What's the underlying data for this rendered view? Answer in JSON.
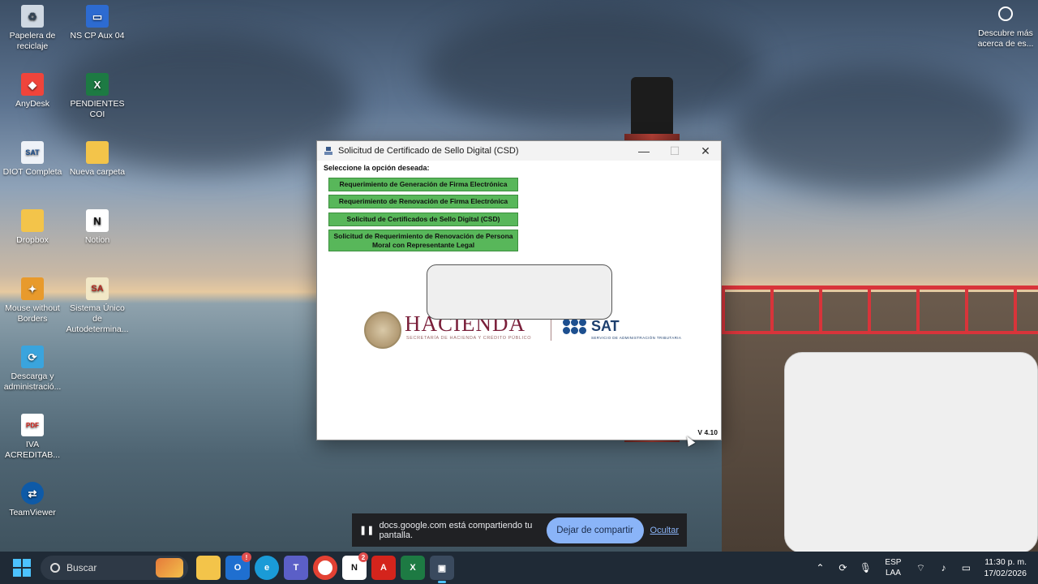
{
  "desktop": {
    "icons": [
      {
        "label": "Papelera de reciclaje",
        "icon": "recycle-bin-icon"
      },
      {
        "label": "NS CP Aux 04",
        "icon": "computer-icon"
      },
      {
        "label": "AnyDesk",
        "icon": "anydesk-icon"
      },
      {
        "label": "PENDIENTES COI",
        "icon": "excel-icon"
      },
      {
        "label": "DIOT Completa",
        "icon": "sat-app-icon"
      },
      {
        "label": "Nueva carpeta",
        "icon": "folder-icon"
      },
      {
        "label": "Dropbox",
        "icon": "folder-shortcut-icon"
      },
      {
        "label": "Notion",
        "icon": "notion-icon"
      },
      {
        "label": "Mouse without Borders",
        "icon": "mouse-without-borders-icon"
      },
      {
        "label": "Sistema Único de Autodetermina...",
        "icon": "sua-icon"
      },
      {
        "label": "Descarga y administració...",
        "icon": "download-admin-icon"
      },
      {
        "label": "IVA ACREDITAB...",
        "icon": "pdf-icon"
      },
      {
        "label": "TeamViewer",
        "icon": "teamviewer-icon"
      }
    ],
    "discover": {
      "label": "Descubre más acerca de es...",
      "icon": "camera-icon"
    }
  },
  "dialog": {
    "title": "Solicitud de Certificado de Sello Digital (CSD)",
    "prompt": "Seleccione la opción deseada:",
    "options": [
      "Requerimiento de Generación de Firma Electrónica",
      "Requerimiento de Renovación de Firma Electrónica",
      "Solicitud de Certificados de Sello Digital (CSD)",
      "Solicitud de Requerimiento de Renovación de Persona Moral con Representante Legal"
    ],
    "logo_hacienda": "HACIENDA",
    "logo_hacienda_sub": "SECRETARÍA DE HACIENDA Y CRÉDITO PÚBLICO",
    "logo_sat": "SAT",
    "logo_sat_sub": "SERVICIO DE ADMINISTRACIÓN TRIBUTARIA",
    "version": "V 4.10",
    "button_color": "#58b75a"
  },
  "share_bar": {
    "message": "docs.google.com está compartiendo tu pantalla.",
    "stop_label": "Dejar de compartir",
    "hide_label": "Ocultar"
  },
  "taskbar": {
    "search_placeholder": "Buscar",
    "apps": [
      "file-explorer-icon",
      "outlook-icon",
      "edge-icon",
      "teams-icon",
      "chrome-icon",
      "notion-icon",
      "acrobat-icon",
      "excel-icon",
      "sat-app-icon"
    ],
    "language": "ESP",
    "layout": "LAA",
    "time": "11:30 p. m.",
    "date": "17/02/2026"
  }
}
